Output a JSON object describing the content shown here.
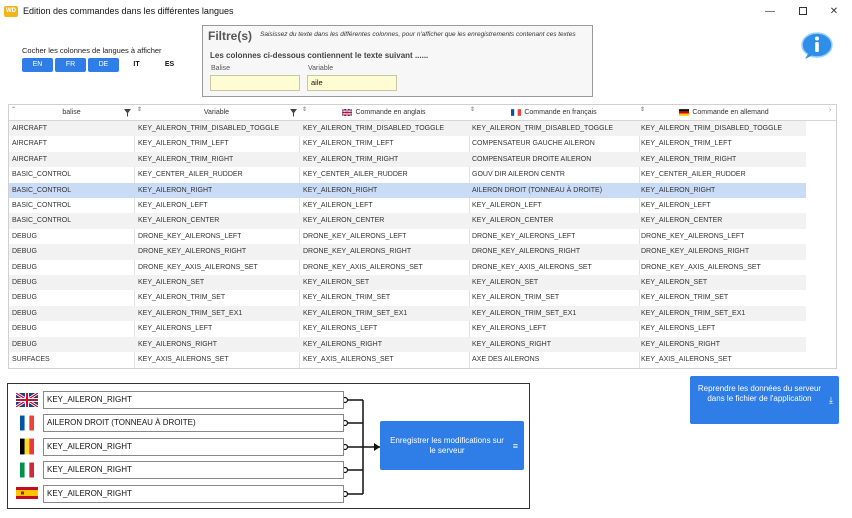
{
  "window": {
    "title": "Edition des commandes dans les différentes langues",
    "app_icon_text": "WD",
    "minimize": "—",
    "close": "✕"
  },
  "languages": {
    "title": "Cocher les colonnes de langues à afficher",
    "toggles": [
      {
        "label": "EN",
        "active": true
      },
      {
        "label": "FR",
        "active": true
      },
      {
        "label": "DE",
        "active": true
      },
      {
        "label": "IT",
        "active": false
      },
      {
        "label": "ES",
        "active": false
      }
    ]
  },
  "filter": {
    "title": "Filtre(s)",
    "description": "Saisissez du texte dans les différentes colonnes, pour n'afficher que les enregistrements contenant ces textes",
    "subtitle": "Les colonnes ci-dessous contiennent le texte suivant ......",
    "balise_label": "Balise",
    "balise_value": "",
    "variable_label": "Variable",
    "variable_value": "aile"
  },
  "table": {
    "headers": {
      "balise": "balise",
      "variable": "Variable",
      "en": "Commande en anglais",
      "fr": "Commande en français",
      "de": "Commande en allemand"
    },
    "rows": [
      [
        "AIRCRAFT",
        "KEY_AILERON_TRIM_DISABLED_TOGGLE",
        "KEY_AILERON_TRIM_DISABLED_TOGGLE",
        "KEY_AILERON_TRIM_DISABLED_TOGGLE",
        "KEY_AILERON_TRIM_DISABLED_TOGGLE"
      ],
      [
        "AIRCRAFT",
        "KEY_AILERON_TRIM_LEFT",
        "KEY_AILERON_TRIM_LEFT",
        "COMPENSATEUR GAUCHE AILERON",
        "KEY_AILERON_TRIM_LEFT"
      ],
      [
        "AIRCRAFT",
        "KEY_AILERON_TRIM_RIGHT",
        "KEY_AILERON_TRIM_RIGHT",
        "COMPENSATEUR DROITE AILERON",
        "KEY_AILERON_TRIM_RIGHT"
      ],
      [
        "BASIC_CONTROL",
        "KEY_CENTER_AILER_RUDDER",
        "KEY_CENTER_AILER_RUDDER",
        "GOUV DIR AILERON CENTR",
        "KEY_CENTER_AILER_RUDDER"
      ],
      [
        "BASIC_CONTROL",
        "KEY_AILERON_RIGHT",
        "KEY_AILERON_RIGHT",
        "AILERON DROIT (TONNEAU À DROITE)",
        "KEY_AILERON_RIGHT"
      ],
      [
        "BASIC_CONTROL",
        "KEY_AILERON_LEFT",
        "KEY_AILERON_LEFT",
        "KEY_AILERON_LEFT",
        "KEY_AILERON_LEFT"
      ],
      [
        "BASIC_CONTROL",
        "KEY_AILERON_CENTER",
        "KEY_AILERON_CENTER",
        "KEY_AILERON_CENTER",
        "KEY_AILERON_CENTER"
      ],
      [
        "DEBUG",
        "DRONE_KEY_AILERONS_LEFT",
        "DRONE_KEY_AILERONS_LEFT",
        "DRONE_KEY_AILERONS_LEFT",
        "DRONE_KEY_AILERONS_LEFT"
      ],
      [
        "DEBUG",
        "DRONE_KEY_AILERONS_RIGHT",
        "DRONE_KEY_AILERONS_RIGHT",
        "DRONE_KEY_AILERONS_RIGHT",
        "DRONE_KEY_AILERONS_RIGHT"
      ],
      [
        "DEBUG",
        "DRONE_KEY_AXIS_AILERONS_SET",
        "DRONE_KEY_AXIS_AILERONS_SET",
        "DRONE_KEY_AXIS_AILERONS_SET",
        "DRONE_KEY_AXIS_AILERONS_SET"
      ],
      [
        "DEBUG",
        "KEY_AILERON_SET",
        "KEY_AILERON_SET",
        "KEY_AILERON_SET",
        "KEY_AILERON_SET"
      ],
      [
        "DEBUG",
        "KEY_AILERON_TRIM_SET",
        "KEY_AILERON_TRIM_SET",
        "KEY_AILERON_TRIM_SET",
        "KEY_AILERON_TRIM_SET"
      ],
      [
        "DEBUG",
        "KEY_AILERON_TRIM_SET_EX1",
        "KEY_AILERON_TRIM_SET_EX1",
        "KEY_AILERON_TRIM_SET_EX1",
        "KEY_AILERON_TRIM_SET_EX1"
      ],
      [
        "DEBUG",
        "KEY_AILERONS_LEFT",
        "KEY_AILERONS_LEFT",
        "KEY_AILERONS_LEFT",
        "KEY_AILERONS_LEFT"
      ],
      [
        "DEBUG",
        "KEY_AILERONS_RIGHT",
        "KEY_AILERONS_RIGHT",
        "KEY_AILERONS_RIGHT",
        "KEY_AILERONS_RIGHT"
      ],
      [
        "SURFACES",
        "KEY_AXIS_AILERONS_SET",
        "KEY_AXIS_AILERONS_SET",
        "AXE DES AILERONS",
        "KEY_AXIS_AILERONS_SET"
      ]
    ],
    "selected_row": 4
  },
  "editor": {
    "fields": [
      {
        "lang": "en",
        "flag": "uk-flag-icon",
        "value": "KEY_AILERON_RIGHT"
      },
      {
        "lang": "fr",
        "flag": "france-flag-icon",
        "value": "AILERON DROIT (TONNEAU À DROITE)"
      },
      {
        "lang": "de",
        "flag": "belgium-flag-icon",
        "value": "KEY_AILERON_RIGHT"
      },
      {
        "lang": "it",
        "flag": "italy-flag-icon",
        "value": "KEY_AILERON_RIGHT"
      },
      {
        "lang": "es",
        "flag": "spain-flag-icon",
        "value": "KEY_AILERON_RIGHT"
      }
    ],
    "save_label": "Enregistrer les modifications sur le serveur"
  },
  "reload_label": "Reprendre les données du serveur dans le fichier de l'application",
  "colors": {
    "accent": "#2f7de6",
    "selected_row": "#c9dbf5",
    "input_bg": "#fffbd2"
  }
}
